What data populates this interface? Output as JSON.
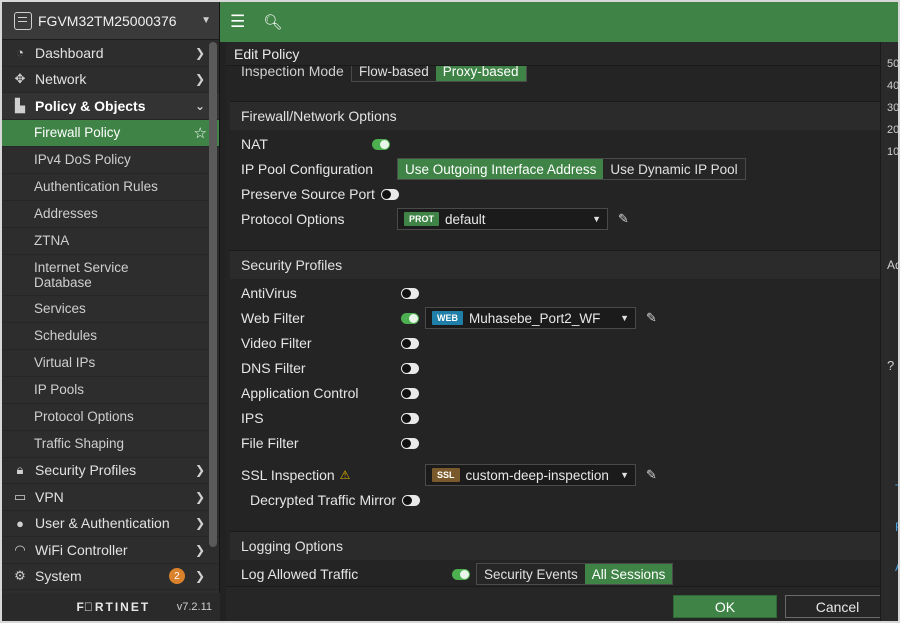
{
  "device": {
    "name": "FGVM32TM25000376"
  },
  "sidebar": {
    "items": [
      {
        "label": "Dashboard",
        "icon": "dashboard-icon"
      },
      {
        "label": "Network",
        "icon": "network-icon"
      },
      {
        "label": "Policy & Objects",
        "icon": "policy-icon"
      }
    ],
    "sub_items": [
      {
        "label": "Firewall Policy"
      },
      {
        "label": "IPv4 DoS Policy"
      },
      {
        "label": "Authentication Rules"
      },
      {
        "label": "Addresses"
      },
      {
        "label": "ZTNA"
      },
      {
        "label": "Internet Service Database"
      },
      {
        "label": "Services"
      },
      {
        "label": "Schedules"
      },
      {
        "label": "Virtual IPs"
      },
      {
        "label": "IP Pools"
      },
      {
        "label": "Protocol Options"
      },
      {
        "label": "Traffic Shaping"
      }
    ],
    "bottom_items": [
      {
        "label": "Security Profiles"
      },
      {
        "label": "VPN"
      },
      {
        "label": "User & Authentication"
      },
      {
        "label": "WiFi Controller"
      },
      {
        "label": "System",
        "badge": "2"
      }
    ],
    "logo": "F⃞RTINET",
    "version": "v7.2.11"
  },
  "dialog": {
    "title": "Edit Policy",
    "inspection_mode": {
      "label": "Inspection Mode",
      "options": [
        "Flow-based",
        "Proxy-based"
      ],
      "selected": "Proxy-based"
    },
    "firewall_section": {
      "title": "Firewall/Network Options",
      "nat": {
        "label": "NAT",
        "on": true
      },
      "ip_pool": {
        "label": "IP Pool Configuration",
        "options": [
          "Use Outgoing Interface Address",
          "Use Dynamic IP Pool"
        ],
        "selected": "Use Outgoing Interface Address"
      },
      "preserve_port": {
        "label": "Preserve Source Port",
        "on": false
      },
      "protocol_options": {
        "label": "Protocol Options",
        "tag": "PROT",
        "value": "default"
      }
    },
    "security_section": {
      "title": "Security Profiles",
      "antivirus": {
        "label": "AntiVirus",
        "on": false
      },
      "web_filter": {
        "label": "Web Filter",
        "on": true,
        "tag": "WEB",
        "value": "Muhasebe_Port2_WF"
      },
      "video_filter": {
        "label": "Video Filter",
        "on": false
      },
      "dns_filter": {
        "label": "DNS Filter",
        "on": false
      },
      "app_control": {
        "label": "Application Control",
        "on": false
      },
      "ips": {
        "label": "IPS",
        "on": false
      },
      "file_filter": {
        "label": "File Filter",
        "on": false
      },
      "ssl_inspection": {
        "label": "SSL Inspection",
        "tag": "SSL",
        "value": "custom-deep-inspection"
      },
      "decrypted_mirror": {
        "label": "Decrypted Traffic Mirror",
        "on": false
      }
    },
    "logging_section": {
      "title": "Logging Options",
      "log_allowed": {
        "label": "Log Allowed Traffic",
        "on": true,
        "options": [
          "Security Events",
          "All Sessions"
        ],
        "selected": "All Sessions"
      }
    },
    "ok_label": "OK",
    "cancel_label": "Cancel"
  },
  "right_panel": {
    "ticks": [
      "40",
      "30",
      "20",
      "10"
    ],
    "partial_label": "Ad",
    "links": [
      "T",
      "F",
      "A"
    ]
  },
  "colors": {
    "accent": "#3f8446",
    "toggle_on": "#4caf50",
    "web_tag": "#1f7fa8",
    "ssl_tag": "#7a5a2c",
    "prot_tag": "#3f8446",
    "badge": "#d9822b"
  }
}
